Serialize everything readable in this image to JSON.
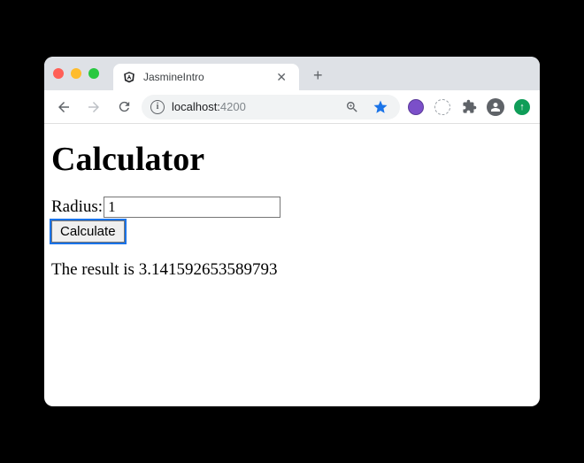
{
  "tab": {
    "title": "JasmineIntro"
  },
  "address": {
    "host": "localhost:",
    "port": "4200"
  },
  "page": {
    "heading": "Calculator",
    "radius_label": "Radius:",
    "radius_value": "1",
    "calc_button": "Calculate",
    "result_prefix": "The result is ",
    "result_value": "3.141592653589793"
  }
}
